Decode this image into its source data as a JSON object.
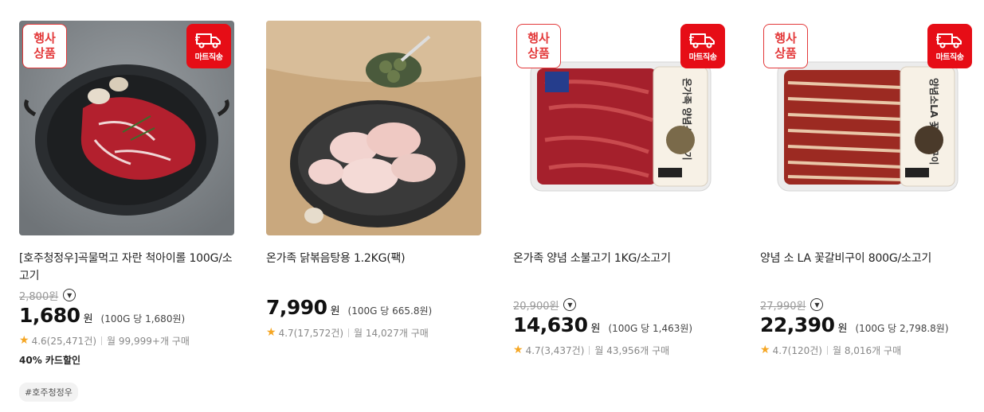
{
  "badges": {
    "event_line1": "행사",
    "event_line2": "상품",
    "mart": "마트직송"
  },
  "products": [
    {
      "title": "[호주청정우]곡물먹고 자란 척아이롤 100G/소고기",
      "original_price": "2,800원",
      "price": "1,680",
      "won": "원",
      "unit_price": "(100G 당 1,680원)",
      "rating": "4.6(25,471건)",
      "purchases": "월 99,999+개 구매",
      "discount": "40% 카드할인",
      "tag": "#호주청정우"
    },
    {
      "title": "온가족 닭볶음탕용 1.2KG(팩)",
      "original_price": "",
      "price": "7,990",
      "won": "원",
      "unit_price": "(100G 당 665.8원)",
      "rating": "4.7(17,572건)",
      "purchases": "월 14,027개 구매"
    },
    {
      "title": "온가족 양념 소불고기 1KG/소고기",
      "original_price": "20,900원",
      "price": "14,630",
      "won": "원",
      "unit_price": "(100G 당 1,463원)",
      "rating": "4.7(3,437건)",
      "purchases": "월 43,956개 구매",
      "package_label": "온가족 양념소불고기"
    },
    {
      "title": "양념 소 LA 꽃갈비구이 800G/소고기",
      "original_price": "27,990원",
      "price": "22,390",
      "won": "원",
      "unit_price": "(100G 당 2,798.8원)",
      "rating": "4.7(120건)",
      "purchases": "월 8,016개 구매",
      "package_label": "양념소LA 꽃갈비구이"
    }
  ]
}
